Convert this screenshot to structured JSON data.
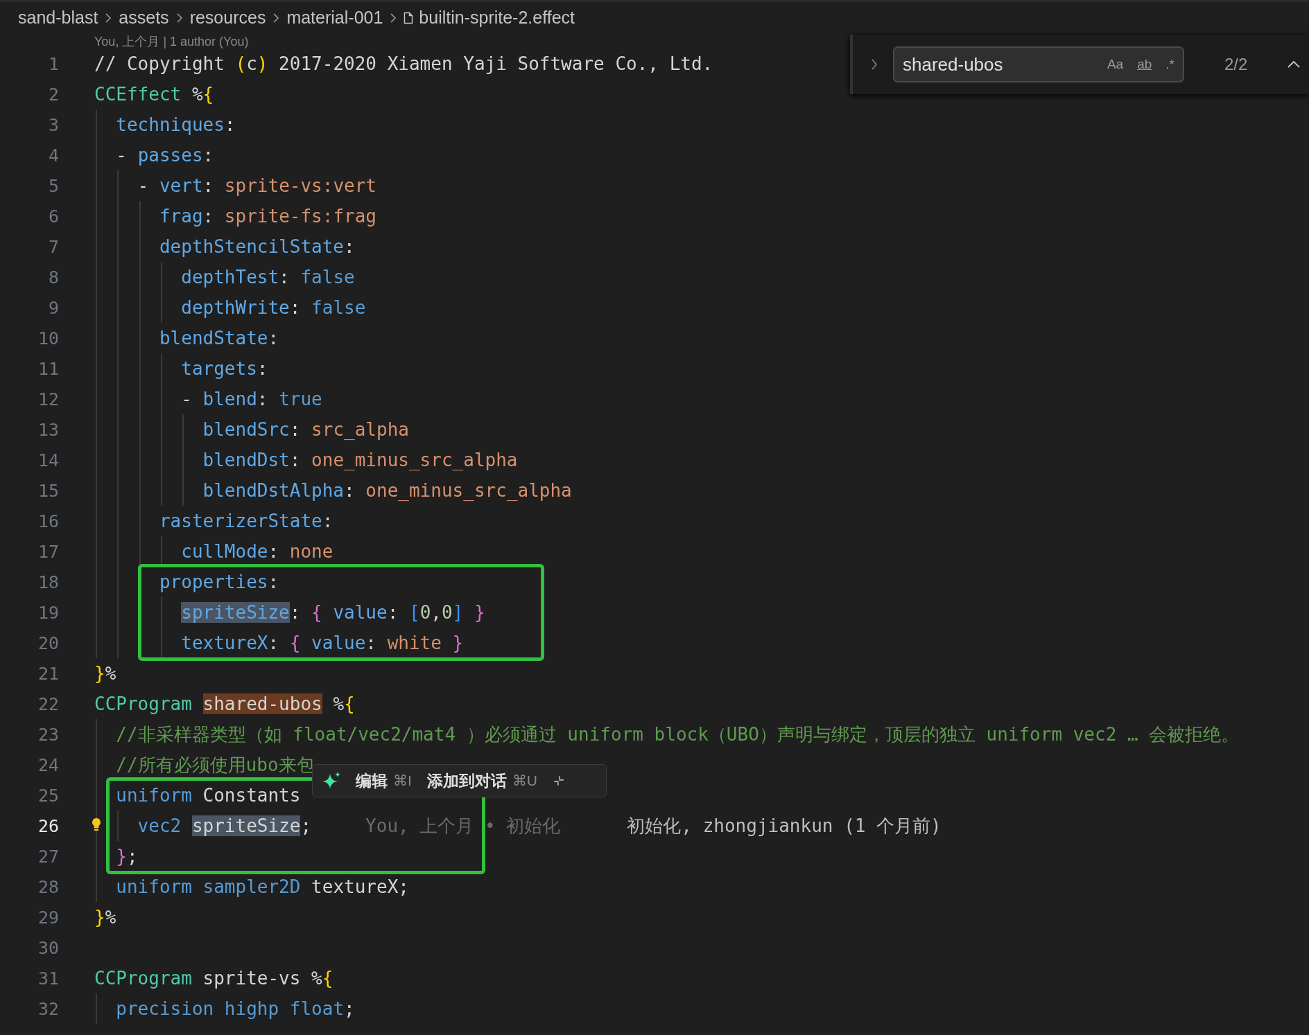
{
  "breadcrumb": {
    "items": [
      {
        "label": "sand-blast",
        "kind": "folder"
      },
      {
        "label": "assets",
        "kind": "folder"
      },
      {
        "label": "resources",
        "kind": "folder"
      },
      {
        "label": "material-001",
        "kind": "folder"
      },
      {
        "label": "builtin-sprite-2.effect",
        "kind": "file"
      }
    ]
  },
  "codelens": "You, 上个月 | 1 author (You)",
  "find_widget": {
    "query": "shared-ubos",
    "options": [
      "Aa",
      "ab",
      ".*"
    ],
    "count": "2/2"
  },
  "inline_popup": {
    "actions": [
      {
        "label": "编辑",
        "shortcut": "⌘I"
      },
      {
        "label": "添加到对话",
        "shortcut": "⌘U"
      }
    ]
  },
  "lines": [
    {
      "number": "1",
      "tokens": [
        {
          "text": "// Copyright ",
          "kind": "plain"
        },
        {
          "text": "(",
          "kind": "brace1"
        },
        {
          "text": "c",
          "kind": "plain"
        },
        {
          "text": ")",
          "kind": "brace1"
        },
        {
          "text": " 2017-2020 Xiamen Yaji Software Co., Ltd.",
          "kind": "plain"
        }
      ]
    },
    {
      "number": "2",
      "tokens": [
        {
          "text": "CCEffect",
          "kind": "keyword"
        },
        {
          "text": " %",
          "kind": "plain"
        },
        {
          "text": "{",
          "kind": "brace1"
        }
      ]
    },
    {
      "number": "3",
      "tokens": [
        {
          "text": "  techniques",
          "kind": "key"
        },
        {
          "text": ":",
          "kind": "plain"
        }
      ]
    },
    {
      "number": "4",
      "tokens": [
        {
          "text": "  - ",
          "kind": "plain"
        },
        {
          "text": "passes",
          "kind": "key"
        },
        {
          "text": ":",
          "kind": "plain"
        }
      ]
    },
    {
      "number": "5",
      "tokens": [
        {
          "text": "    - ",
          "kind": "plain"
        },
        {
          "text": "vert",
          "kind": "key"
        },
        {
          "text": ": ",
          "kind": "plain"
        },
        {
          "text": "sprite-vs:vert",
          "kind": "string"
        }
      ]
    },
    {
      "number": "6",
      "tokens": [
        {
          "text": "      frag",
          "kind": "key"
        },
        {
          "text": ": ",
          "kind": "plain"
        },
        {
          "text": "sprite-fs:frag",
          "kind": "string"
        }
      ]
    },
    {
      "number": "7",
      "tokens": [
        {
          "text": "      depthStencilState",
          "kind": "key"
        },
        {
          "text": ":",
          "kind": "plain"
        }
      ]
    },
    {
      "number": "8",
      "tokens": [
        {
          "text": "        depthTest",
          "kind": "key"
        },
        {
          "text": ": ",
          "kind": "plain"
        },
        {
          "text": "false",
          "kind": "value"
        }
      ]
    },
    {
      "number": "9",
      "tokens": [
        {
          "text": "        depthWrite",
          "kind": "key"
        },
        {
          "text": ": ",
          "kind": "plain"
        },
        {
          "text": "false",
          "kind": "value"
        }
      ]
    },
    {
      "number": "10",
      "tokens": [
        {
          "text": "      blendState",
          "kind": "key"
        },
        {
          "text": ":",
          "kind": "plain"
        }
      ]
    },
    {
      "number": "11",
      "tokens": [
        {
          "text": "        targets",
          "kind": "key"
        },
        {
          "text": ":",
          "kind": "plain"
        }
      ]
    },
    {
      "number": "12",
      "tokens": [
        {
          "text": "        - ",
          "kind": "plain"
        },
        {
          "text": "blend",
          "kind": "key"
        },
        {
          "text": ": ",
          "kind": "plain"
        },
        {
          "text": "true",
          "kind": "value"
        }
      ]
    },
    {
      "number": "13",
      "tokens": [
        {
          "text": "          blendSrc",
          "kind": "key"
        },
        {
          "text": ": ",
          "kind": "plain"
        },
        {
          "text": "src_alpha",
          "kind": "string"
        }
      ]
    },
    {
      "number": "14",
      "tokens": [
        {
          "text": "          blendDst",
          "kind": "key"
        },
        {
          "text": ": ",
          "kind": "plain"
        },
        {
          "text": "one_minus_src_alpha",
          "kind": "string"
        }
      ]
    },
    {
      "number": "15",
      "tokens": [
        {
          "text": "          blendDstAlpha",
          "kind": "key"
        },
        {
          "text": ": ",
          "kind": "plain"
        },
        {
          "text": "one_minus_src_alpha",
          "kind": "string"
        }
      ]
    },
    {
      "number": "16",
      "tokens": [
        {
          "text": "      rasterizerState",
          "kind": "key"
        },
        {
          "text": ":",
          "kind": "plain"
        }
      ]
    },
    {
      "number": "17",
      "tokens": [
        {
          "text": "        cullMode",
          "kind": "key"
        },
        {
          "text": ": ",
          "kind": "plain"
        },
        {
          "text": "none",
          "kind": "string"
        }
      ]
    },
    {
      "number": "18",
      "boxed": true,
      "tokens": [
        {
          "text": "      properties",
          "kind": "key"
        },
        {
          "text": ":",
          "kind": "plain"
        }
      ]
    },
    {
      "number": "19",
      "boxed": true,
      "tokens": [
        {
          "text": "        spriteSize",
          "kind": "key",
          "selection": true
        },
        {
          "text": ": ",
          "kind": "plain"
        },
        {
          "text": "{",
          "kind": "brace2"
        },
        {
          "text": " value",
          "kind": "key"
        },
        {
          "text": ": ",
          "kind": "plain"
        },
        {
          "text": "[",
          "kind": "brace3"
        },
        {
          "text": "0",
          "kind": "number"
        },
        {
          "text": ",",
          "kind": "plain"
        },
        {
          "text": "0",
          "kind": "number"
        },
        {
          "text": "]",
          "kind": "brace3"
        },
        {
          "text": " }",
          "kind": "brace2"
        }
      ]
    },
    {
      "number": "20",
      "boxed": true,
      "tokens": [
        {
          "text": "        textureX",
          "kind": "key"
        },
        {
          "text": ": ",
          "kind": "plain"
        },
        {
          "text": "{",
          "kind": "brace2"
        },
        {
          "text": " value",
          "kind": "key"
        },
        {
          "text": ": ",
          "kind": "plain"
        },
        {
          "text": "white",
          "kind": "string"
        },
        {
          "text": " }",
          "kind": "brace2"
        }
      ]
    },
    {
      "number": "21",
      "tokens": [
        {
          "text": "}",
          "kind": "brace1"
        },
        {
          "text": "%",
          "kind": "plain"
        }
      ]
    },
    {
      "number": "22",
      "tokens": [
        {
          "text": "CCProgram",
          "kind": "keyword"
        },
        {
          "text": " shared-ubos",
          "kind": "plain",
          "find_match": true
        },
        {
          "text": " %",
          "kind": "plain"
        },
        {
          "text": "{",
          "kind": "brace1"
        }
      ]
    },
    {
      "number": "23",
      "tokens": [
        {
          "text": "  //非采样器类型（如 float/vec2/mat4 ）必须通过 uniform block（UBO）声明与绑定，顶层的独立 uniform vec2 … 会被拒绝。",
          "kind": "comment"
        }
      ]
    },
    {
      "number": "24",
      "tokens": [
        {
          "text": "  //所有必须使用ubo来包",
          "kind": "comment"
        }
      ]
    },
    {
      "number": "25",
      "boxed": true,
      "tokens": [
        {
          "text": "  uniform",
          "kind": "value"
        },
        {
          "text": " Constants",
          "kind": "plain"
        }
      ]
    },
    {
      "number": "26",
      "boxed": true,
      "current": true,
      "lightbulb": true,
      "tokens": [
        {
          "text": "    vec2",
          "kind": "value"
        },
        {
          "text": " spriteSize",
          "kind": "plain",
          "selection": true
        },
        {
          "text": ";",
          "kind": "plain"
        }
      ],
      "blame": [
        "You, 上个月 • 初始化",
        "初始化, zhongjiankun (1 个月前)"
      ]
    },
    {
      "number": "27",
      "boxed": true,
      "tokens": [
        {
          "text": "  }",
          "kind": "brace2"
        },
        {
          "text": ";",
          "kind": "plain"
        }
      ]
    },
    {
      "number": "28",
      "tokens": [
        {
          "text": "  uniform",
          "kind": "value"
        },
        {
          "text": " sampler2D",
          "kind": "value"
        },
        {
          "text": " textureX;",
          "kind": "plain"
        }
      ]
    },
    {
      "number": "29",
      "tokens": [
        {
          "text": "}",
          "kind": "brace1"
        },
        {
          "text": "%",
          "kind": "plain"
        }
      ]
    },
    {
      "number": "30"
    },
    {
      "number": "31",
      "tokens": [
        {
          "text": "CCProgram",
          "kind": "keyword"
        },
        {
          "text": " sprite-vs %",
          "kind": "plain"
        },
        {
          "text": "{",
          "kind": "brace1"
        }
      ]
    },
    {
      "number": "32",
      "tokens": [
        {
          "text": "  precision",
          "kind": "value"
        },
        {
          "text": " highp",
          "kind": "value"
        },
        {
          "text": " float",
          "kind": "value"
        },
        {
          "text": ";",
          "kind": "plain"
        }
      ]
    }
  ]
}
